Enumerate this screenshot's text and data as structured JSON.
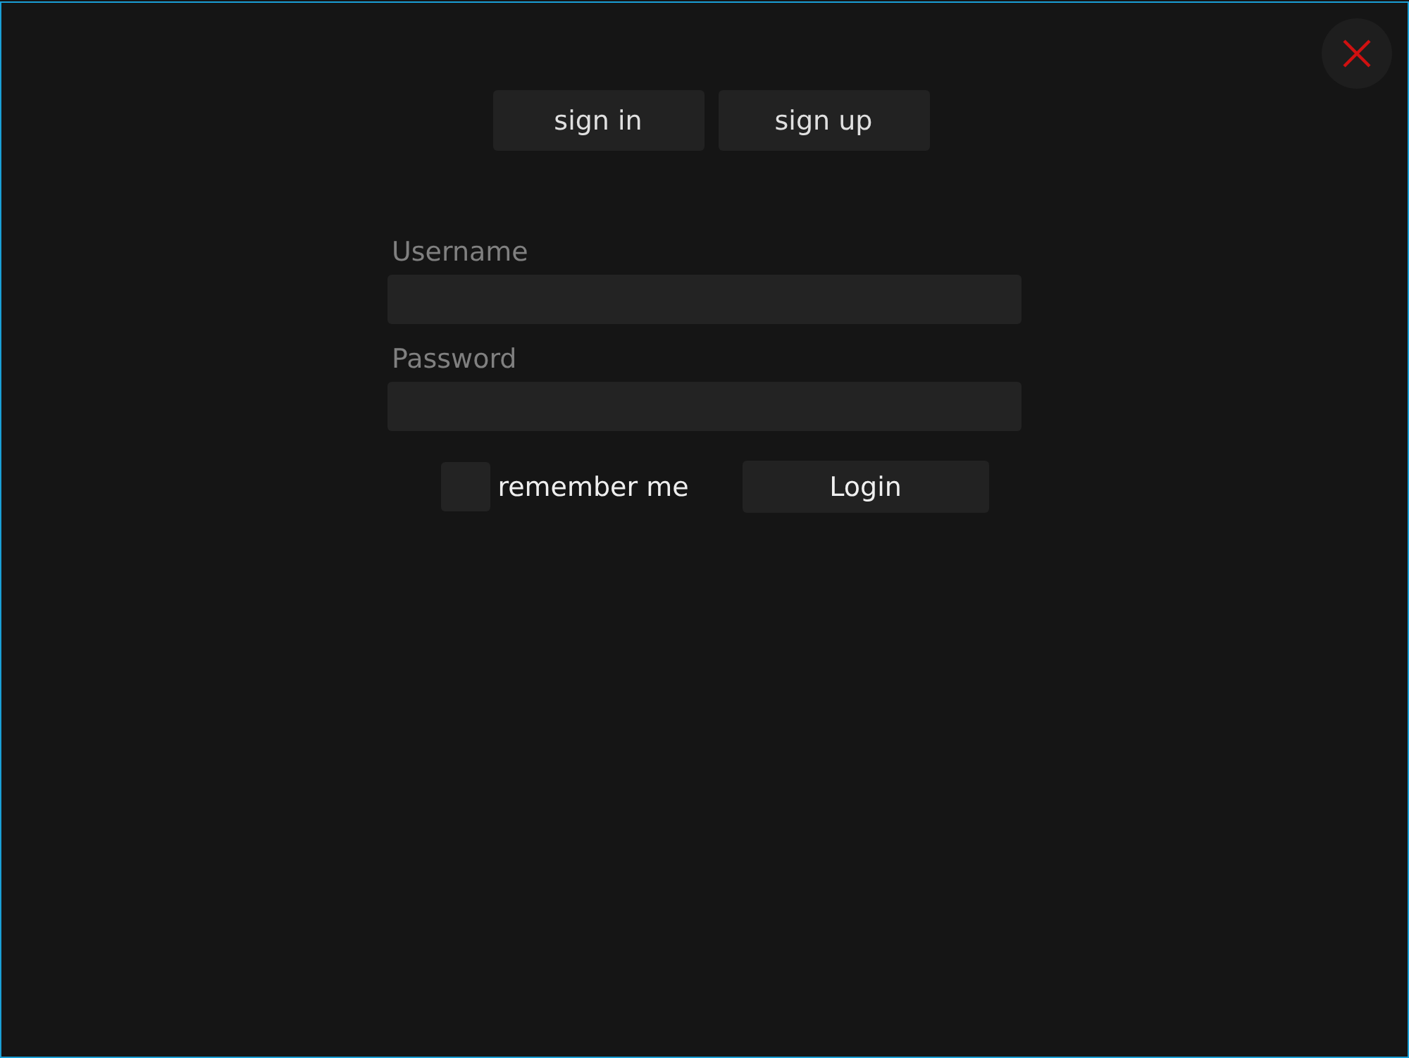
{
  "tabs": [
    {
      "label": "sign in"
    },
    {
      "label": "sign up"
    }
  ],
  "form": {
    "fields": [
      {
        "label": "Username"
      },
      {
        "label": "Password"
      }
    ],
    "remember_me": {
      "label": "remember me",
      "checked": false
    },
    "login_button": "Login"
  }
}
